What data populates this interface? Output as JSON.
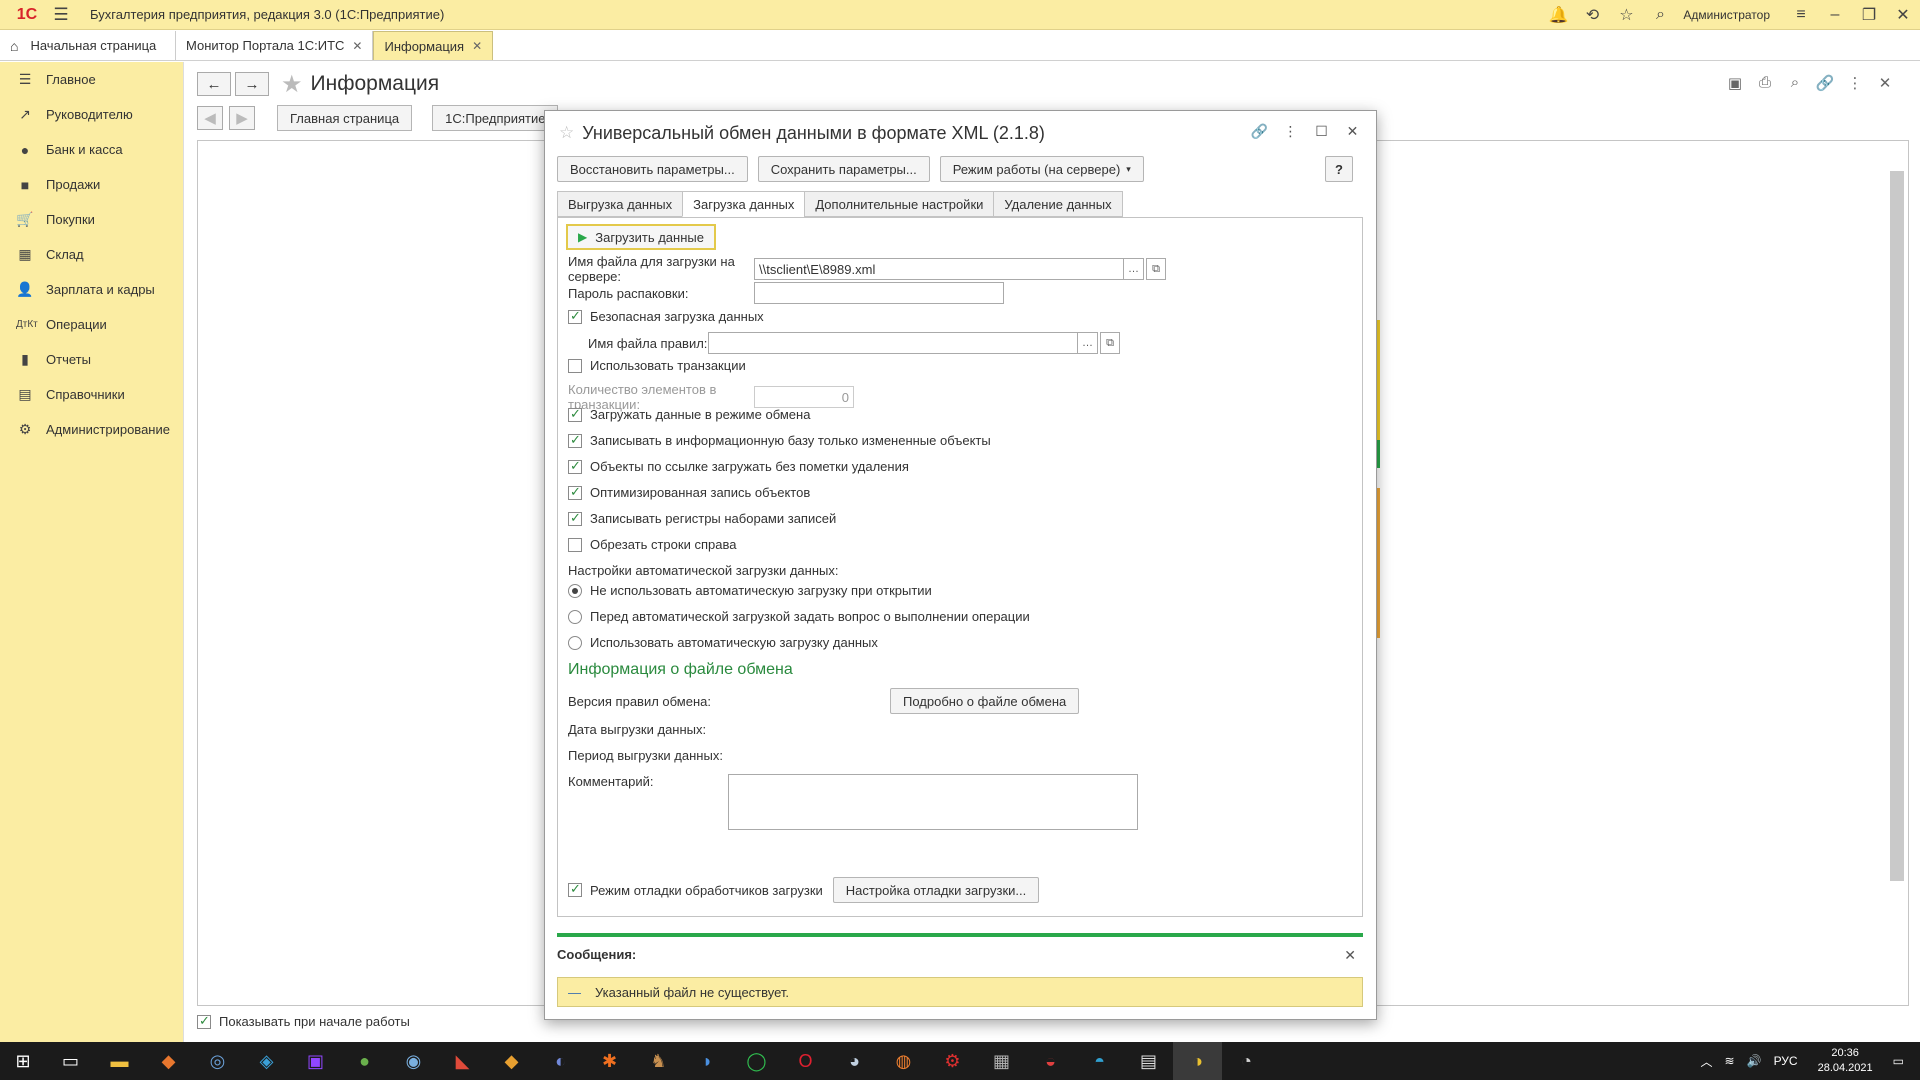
{
  "titlebar": {
    "logo": "1С",
    "app_title": "Бухгалтерия предприятия, редакция 3.0 (1С:Предприятие)",
    "user": "Администратор"
  },
  "tabs": [
    {
      "label": "Начальная страница"
    },
    {
      "label": "Монитор Портала 1С:ИТС"
    },
    {
      "label": "Информация"
    }
  ],
  "sidebar": {
    "items": [
      {
        "label": "Главное",
        "icon": "menu-icon"
      },
      {
        "label": "Руководителю",
        "icon": "trend-icon"
      },
      {
        "label": "Банк и касса",
        "icon": "coin-icon"
      },
      {
        "label": "Продажи",
        "icon": "bag-icon"
      },
      {
        "label": "Покупки",
        "icon": "cart-icon"
      },
      {
        "label": "Склад",
        "icon": "grid-icon"
      },
      {
        "label": "Зарплата и кадры",
        "icon": "person-icon"
      },
      {
        "label": "Операции",
        "icon": "dtkt-icon"
      },
      {
        "label": "Отчеты",
        "icon": "bar-chart-icon"
      },
      {
        "label": "Справочники",
        "icon": "book-icon"
      },
      {
        "label": "Администрирование",
        "icon": "gear-icon"
      }
    ]
  },
  "main": {
    "page_title": "Информация",
    "buttons": [
      "Главная страница",
      "1С:Предприятие"
    ],
    "show_on_start": "Показывать при начале работы"
  },
  "dialog": {
    "title": "Универсальный обмен данными в формате XML (2.1.8)",
    "toolbar": {
      "restore": "Восстановить параметры...",
      "save": "Сохранить параметры...",
      "mode": "Режим работы (на сервере)",
      "help": "?"
    },
    "tabs": [
      "Выгрузка данных",
      "Загрузка данных",
      "Дополнительные настройки",
      "Удаление данных"
    ],
    "load_button": "Загрузить данные",
    "file_label": "Имя файла для загрузки на сервере:",
    "file_value": "\\\\tsclient\\E\\8989.xml",
    "password_label": "Пароль распаковки:",
    "safe_load": "Безопасная загрузка данных",
    "rules_file_label": "Имя файла правил:",
    "use_transactions": "Использовать транзакции",
    "tx_count_label": "Количество элементов в транзакции:",
    "tx_count_value": "0",
    "checks": [
      {
        "label": "Загружать данные в режиме обмена",
        "checked": true
      },
      {
        "label": "Записывать в информационную базу только измененные объекты",
        "checked": true
      },
      {
        "label": "Объекты по ссылке загружать без пометки удаления",
        "checked": true
      },
      {
        "label": "Оптимизированная запись объектов",
        "checked": true
      },
      {
        "label": "Записывать регистры наборами записей",
        "checked": true
      },
      {
        "label": "Обрезать строки справа",
        "checked": false
      }
    ],
    "auto_load_title": "Настройки автоматической загрузки данных:",
    "radios": [
      {
        "label": "Не использовать автоматическую загрузку при открытии",
        "selected": true
      },
      {
        "label": "Перед автоматической загрузкой задать вопрос о выполнении операции",
        "selected": false
      },
      {
        "label": "Использовать автоматическую загрузку данных",
        "selected": false
      }
    ],
    "info_section_title": "Информация о файле обмена",
    "rules_version_label": "Версия правил обмена:",
    "details_button": "Подробно о файле обмена",
    "export_date_label": "Дата выгрузки данных:",
    "export_period_label": "Период выгрузки данных:",
    "comment_label": "Комментарий:",
    "debug_mode": "Режим отладки обработчиков загрузки",
    "debug_settings_button": "Настройка отладки загрузки...",
    "messages_title": "Сообщения:",
    "message_text": "Указанный файл не существует."
  },
  "tray": {
    "lang": "РУС",
    "time": "20:36",
    "date": "28.04.2021"
  },
  "colors": {
    "accent_yellow": "#fbeda3",
    "accent_green": "#2aa84a",
    "section_green": "#2a8a3e"
  }
}
